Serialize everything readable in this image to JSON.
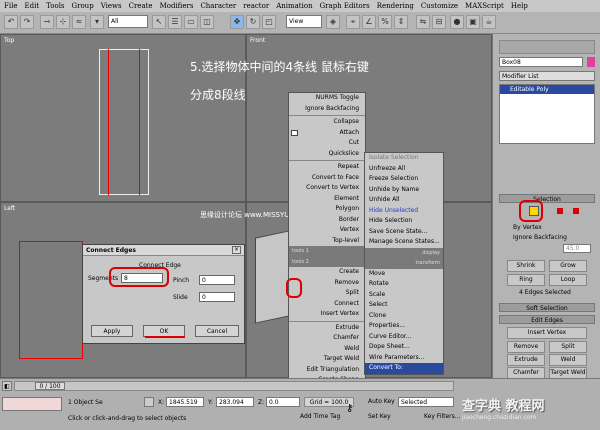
{
  "menu": [
    "File",
    "Edit",
    "Tools",
    "Group",
    "Views",
    "Create",
    "Modifiers",
    "Character",
    "reactor",
    "Animation",
    "Graph Editors",
    "Rendering",
    "Customize",
    "MAXScript",
    "Help"
  ],
  "toolbar": {
    "filter_select": "All",
    "view_select": "View"
  },
  "viewports": {
    "top": "Top",
    "front": "Front",
    "left": "Left"
  },
  "annotation": {
    "line1": "5.选择物体中间的4条线  鼠标右键",
    "line2": "分成8段线"
  },
  "watermark": "思缘设计论坛  www.MISSYUAN.COM",
  "quad_left": {
    "items": [
      "NURMS Toggle",
      "Ignore Backfacing",
      "Collapse",
      "Attach",
      "Cut",
      "Quickslice",
      "Repeat",
      "Convert to Face",
      "Convert to Vertex",
      "Element",
      "Polygon",
      "Border",
      "Vertex",
      "Top-level"
    ],
    "header_tools1": "tools 1",
    "header_tools2": "tools 2",
    "items2": [
      "Create",
      "Remove",
      "Split",
      "Connect",
      "Insert Vertex",
      "Extrude",
      "Chamfer",
      "Weld",
      "Target Weld",
      "Edit Triangulation",
      "Create Shape"
    ]
  },
  "quad_right": {
    "items": [
      "Isolate Selection",
      "Unfreeze All",
      "Freeze Selection",
      "Unhide by Name",
      "Unhide All",
      "Hide Unselected",
      "Hide Selection",
      "Save Scene State...",
      "Manage Scene States..."
    ],
    "header_display": "display",
    "header_transform": "transform",
    "items2": [
      "Move",
      "Rotate",
      "Scale",
      "Select",
      "Clone",
      "Properties...",
      "Curve Editor...",
      "Dope Sheet...",
      "Wire Parameters...",
      "Convert To:"
    ]
  },
  "dialog": {
    "title": "Connect Edges",
    "group": "Connect Edge",
    "segments_label": "Segments",
    "segments_value": "8",
    "pinch_label": "Pinch",
    "pinch_value": "0",
    "slide_label": "Slide",
    "slide_value": "0",
    "apply": "Apply",
    "ok": "OK",
    "cancel": "Cancel"
  },
  "right_panel": {
    "object_name": "Box08",
    "modifier_list": "Modifier List",
    "stack_item": "Editable Poly",
    "selection_title": "Selection",
    "by_vertex": "By Vertex",
    "ignore_backfacing": "Ignore Backfacing",
    "by_angle": "45.0",
    "shrink": "Shrink",
    "grow": "Grow",
    "ring": "Ring",
    "loop": "Loop",
    "selected_text": "4 Edges Selected",
    "soft_selection": "Soft Selection",
    "edit_edges": "Edit Edges",
    "insert_vertex": "Insert Vertex",
    "remove": "Remove",
    "split": "Split",
    "extrude": "Extrude",
    "weld": "Weld",
    "chamfer": "Chamfer",
    "target_weld": "Target Weld",
    "bridge": "Bridge",
    "connect": "Connect"
  },
  "status": {
    "frame": "0 / 100",
    "objects": "1 Object Se",
    "prompt": "Click or click-and-drag to select objects",
    "x_label": "X:",
    "x_value": "1845.519",
    "y_label": "Y:",
    "y_value": "283.094",
    "z_label": "Z:",
    "z_value": "0.0",
    "grid": "Grid = 100.0",
    "add_time_tag": "Add Time Tag",
    "auto_key": "Auto Key",
    "selected": "Selected",
    "set_key": "Set Key",
    "key_filters": "Key Filters..."
  },
  "site_watermark": "查字典 教程网",
  "site_url": "jiaocheng.chazidian.com"
}
